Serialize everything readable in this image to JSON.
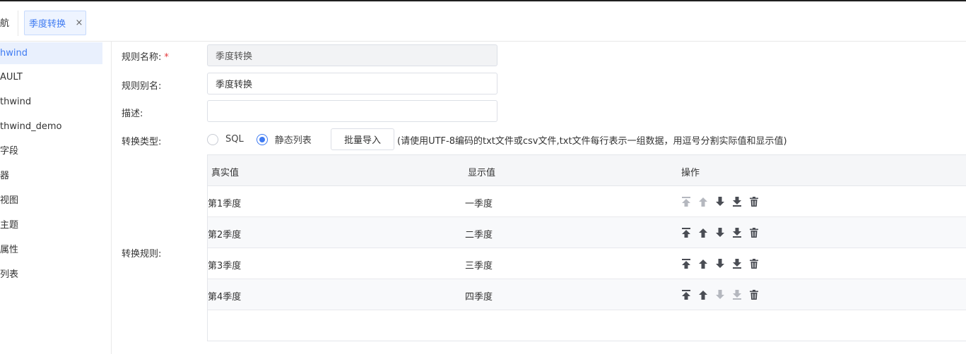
{
  "tabbar": {
    "prev_tab_fragment": "航",
    "active_tab": "季度转换",
    "close_glyph": "×"
  },
  "sidebar": {
    "items": [
      {
        "label": "hwind",
        "active": true
      },
      {
        "label": "AULT",
        "active": false
      },
      {
        "label": "thwind",
        "active": false
      },
      {
        "label": "thwind_demo",
        "active": false
      },
      {
        "label": "字段",
        "active": false
      },
      {
        "label": "器",
        "active": false
      },
      {
        "label": "视图",
        "active": false
      },
      {
        "label": "主题",
        "active": false
      },
      {
        "label": "属性",
        "active": false
      },
      {
        "label": "列表",
        "active": false
      }
    ]
  },
  "form": {
    "rule_name_label": "规则名称:",
    "required_mark": "*",
    "rule_name_value": "季度转换",
    "rule_alias_label": "规则别名:",
    "rule_alias_value": "季度转换",
    "description_label": "描述:",
    "description_value": "",
    "convert_type_label": "转换类型:",
    "radio_sql": "SQL",
    "radio_static": "静态列表",
    "selected_type": "静态列表",
    "import_button": "批量导入",
    "import_hint": "(请使用UTF-8编码的txt文件或csv文件,txt文件每行表示一组数据，用逗号分割实际值和显示值)",
    "convert_rule_label": "转换规则:"
  },
  "table": {
    "columns": [
      "真实值",
      "显示值",
      "操作"
    ],
    "rows": [
      {
        "real": "第1季度",
        "display": "一季度",
        "can_top": false,
        "can_up": false,
        "can_down": true,
        "can_bottom": true
      },
      {
        "real": "第2季度",
        "display": "二季度",
        "can_top": true,
        "can_up": true,
        "can_down": true,
        "can_bottom": true
      },
      {
        "real": "第3季度",
        "display": "三季度",
        "can_top": true,
        "can_up": true,
        "can_down": true,
        "can_bottom": true
      },
      {
        "real": "第4季度",
        "display": "四季度",
        "can_top": true,
        "can_up": true,
        "can_down": false,
        "can_bottom": false
      }
    ]
  },
  "colors": {
    "accent": "#3f7bf2",
    "required": "#e4393c",
    "icon": "#4a4d54",
    "icon_disabled": "#b5b8bf"
  },
  "icons": {
    "move_top": "move-top-icon",
    "move_up": "move-up-icon",
    "move_down": "move-down-icon",
    "move_bottom": "move-bottom-icon",
    "delete": "trash-icon"
  }
}
